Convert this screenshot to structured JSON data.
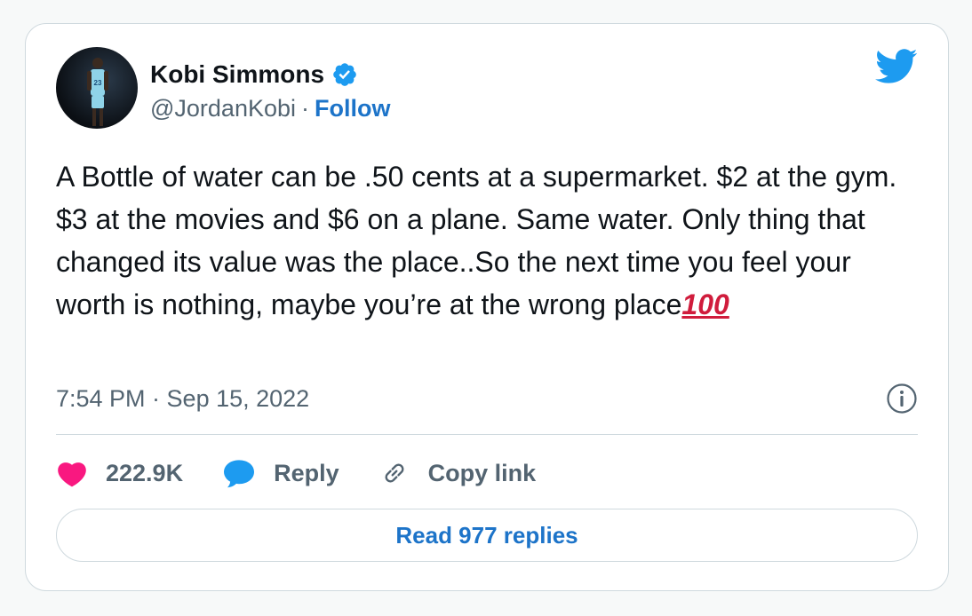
{
  "author": {
    "display_name": "Kobi Simmons",
    "handle": "@JordanKobi",
    "separator": "·",
    "follow_label": "Follow",
    "jersey_number": "23"
  },
  "tweet": {
    "text": "A Bottle of water can be .50 cents at a supermarket. $2 at the gym. $3 at the movies and $6 on a plane. Same water. Only thing that changed its value was the place..So the next time you feel your worth is nothing, maybe you’re at the wrong place",
    "emoji": "100",
    "timestamp": "7:54 PM · Sep 15, 2022"
  },
  "actions": {
    "likes_count": "222.9K",
    "reply_label": "Reply",
    "copy_link_label": "Copy link"
  },
  "read_replies_label": "Read 977 replies",
  "icons": {
    "verified": "verified-badge-icon",
    "brand": "twitter-bird-icon",
    "info": "info-icon",
    "like": "heart-icon",
    "reply": "speech-bubble-icon",
    "copy": "link-icon"
  },
  "colors": {
    "link_blue": "#1d74c9",
    "twitter_blue": "#1d9bf0",
    "heart_pink": "#f91880",
    "muted_text": "#536471",
    "emoji_red": "#d01c3c"
  }
}
